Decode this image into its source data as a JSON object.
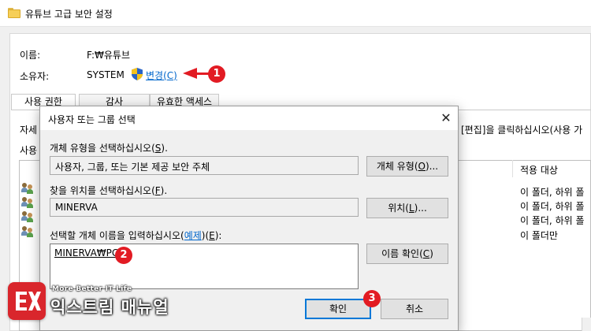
{
  "window": {
    "title": "유튜브 고급 보안 설정"
  },
  "properties": {
    "name_label": "이름:",
    "name_value": "F:₩유튜브",
    "owner_label": "소유자:",
    "owner_value": "SYSTEM",
    "change_prefix": "변경(",
    "change_key": "C",
    "change_suffix": ")"
  },
  "tabs": [
    {
      "label": "사용 권한"
    },
    {
      "label": "감사"
    },
    {
      "label": "유효한 액세스"
    }
  ],
  "background": {
    "desc_left": "자세",
    "desc_right": "[편집]을 클릭하십시오(사용 가",
    "list_label": "사용",
    "column_header": "적용 대상",
    "rows": [
      {
        "applies_to": "이 폴더, 하위 폴"
      },
      {
        "applies_to": "이 폴더, 하위 폴"
      },
      {
        "applies_to": "이 폴더, 하위 폴"
      },
      {
        "applies_to": "이 폴더만"
      }
    ]
  },
  "dialog": {
    "title": "사용자 또는 그룹 선택",
    "object_type_label_prefix": "개체 유형을 선택하십시오(",
    "object_type_label_key": "S",
    "object_type_label_suffix": ").",
    "object_type_value": "사용자, 그룹, 또는 기본 제공 보안 주체",
    "object_type_button_prefix": "개체 유형(",
    "object_type_button_key": "O",
    "object_type_button_suffix": ")...",
    "location_label_prefix": "찾을 위치를 선택하십시오(",
    "location_label_key": "F",
    "location_label_suffix": ").",
    "location_value": "MINERVA",
    "location_button_prefix": "위치(",
    "location_button_key": "L",
    "location_button_suffix": ")...",
    "name_label_prefix": "선택할 개체 이름을 입력하십시오(",
    "name_label_link": "예제",
    "name_label_mid": ")(",
    "name_label_key": "E",
    "name_label_suffix": "):",
    "name_value": "MINERVA₩PG",
    "check_button_prefix": "이름 확인(",
    "check_button_key": "C",
    "check_button_suffix": ")",
    "ok_label": "확인",
    "cancel_label": "취소",
    "close_glyph": "✕"
  },
  "callouts": {
    "one": "1",
    "two": "2",
    "three": "3"
  },
  "watermark": {
    "tagline": "More Better IT Life",
    "brand": "익스트림 매뉴얼",
    "logo_text": "EX"
  },
  "colors": {
    "accent": "#e21b23",
    "link": "#0066cc",
    "focus": "#0078d7"
  }
}
